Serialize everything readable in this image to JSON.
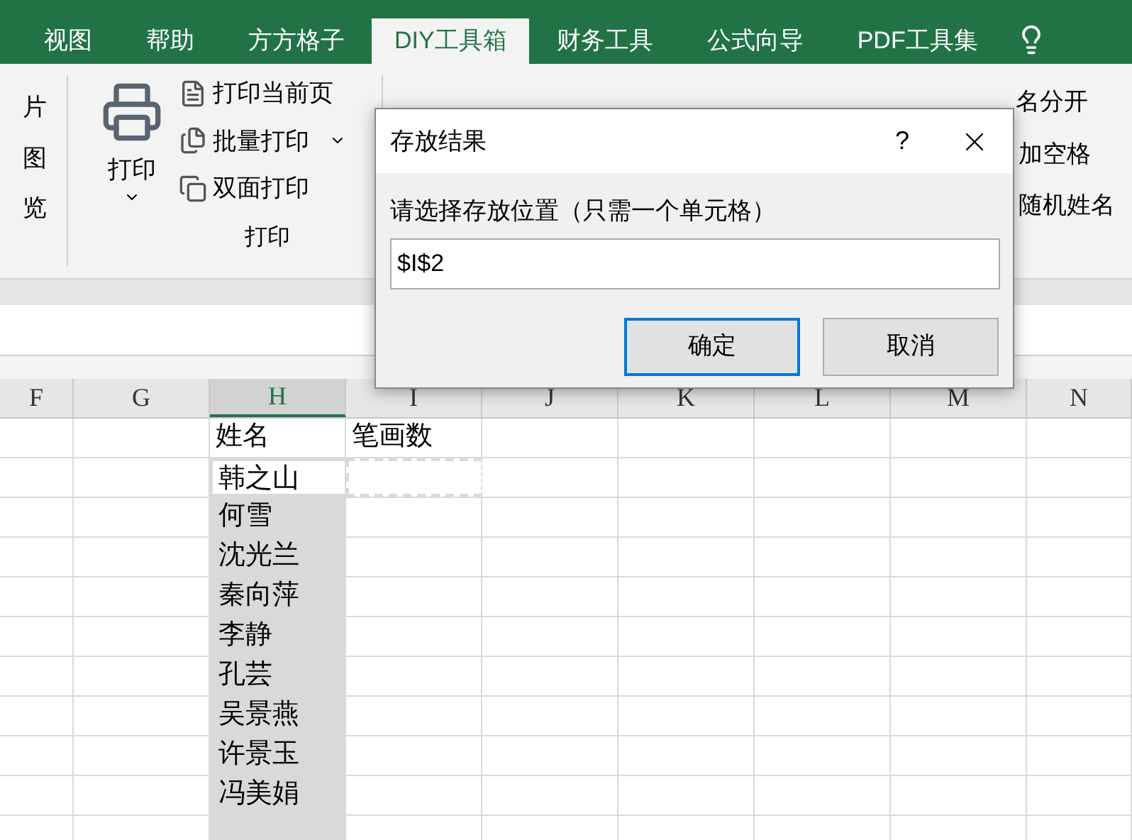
{
  "tabs": [
    {
      "label": "视图",
      "selected": false
    },
    {
      "label": "帮助",
      "selected": false
    },
    {
      "label": "方方格子",
      "selected": false
    },
    {
      "label": "DIY工具箱",
      "selected": true
    },
    {
      "label": "财务工具",
      "selected": false
    },
    {
      "label": "公式向导",
      "selected": false
    },
    {
      "label": "PDF工具集",
      "selected": false
    }
  ],
  "ribbon": {
    "left_items": [
      "片",
      "图",
      "览"
    ],
    "print_group": {
      "big_button": "打印",
      "items": [
        {
          "label": "打印当前页",
          "dropdown": false
        },
        {
          "label": "批量打印",
          "dropdown": true
        },
        {
          "label": "双面打印",
          "dropdown": false
        }
      ],
      "label": "打印"
    },
    "right_items": [
      "名分开",
      "加空格",
      "随机姓名"
    ]
  },
  "sheet": {
    "columns": [
      {
        "label": "F",
        "selected": false
      },
      {
        "label": "G",
        "selected": false
      },
      {
        "label": "H",
        "selected": true
      },
      {
        "label": "I",
        "selected": false
      },
      {
        "label": "J",
        "selected": false
      },
      {
        "label": "K",
        "selected": false
      },
      {
        "label": "L",
        "selected": false
      },
      {
        "label": "M",
        "selected": false
      },
      {
        "label": "N",
        "selected": false
      }
    ],
    "header_row": [
      "姓名",
      "笔画数"
    ],
    "names": [
      "韩之山",
      "何雪",
      "沈光兰",
      "秦向萍",
      "李静",
      "孔芸",
      "吴景燕",
      "许景玉",
      "冯美娟"
    ]
  },
  "dialog": {
    "title": "存放结果",
    "help": "?",
    "prompt": "请选择存放位置（只需一个单元格）",
    "value": "$I$2",
    "buttons": [
      {
        "label": "确定",
        "selected": true
      },
      {
        "label": "取消",
        "selected": false
      }
    ]
  }
}
